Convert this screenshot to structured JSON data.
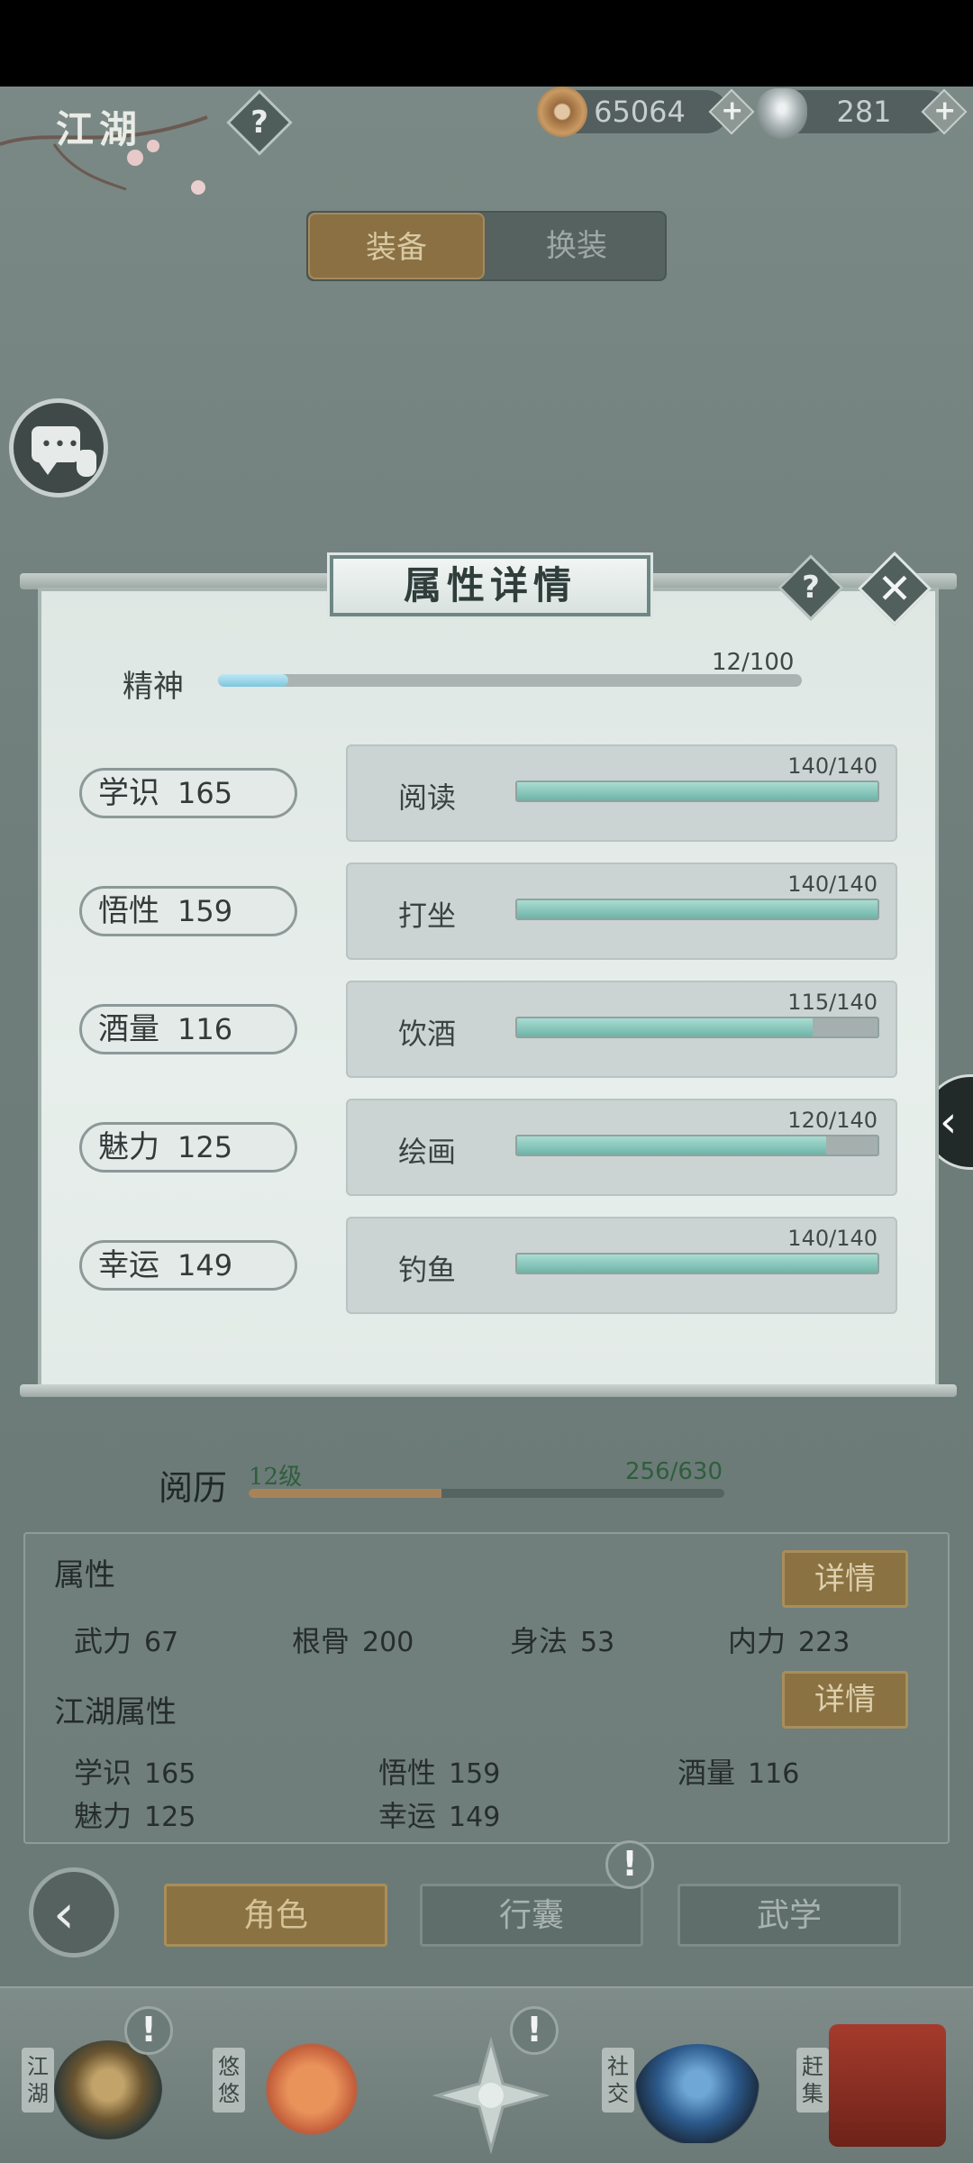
{
  "topbar": {
    "title": "江湖",
    "help_label": "?",
    "coins": "65064",
    "ingots": "281",
    "plus_label": "+"
  },
  "equip_tabs": [
    {
      "label": "装备",
      "active": true
    },
    {
      "label": "换装",
      "active": false
    }
  ],
  "side_arrow_label": "‹",
  "modal": {
    "title": "属性详情",
    "help_label": "?",
    "close_label": "✕",
    "spirit": {
      "label": "精神",
      "value": "12/100",
      "fraction": 0.12
    },
    "stats": [
      {
        "name": "学识",
        "value": "165",
        "skill": "阅读",
        "progress": "140/140",
        "fraction": 1.0
      },
      {
        "name": "悟性",
        "value": "159",
        "skill": "打坐",
        "progress": "140/140",
        "fraction": 1.0
      },
      {
        "name": "酒量",
        "value": "116",
        "skill": "饮酒",
        "progress": "115/140",
        "fraction": 0.821
      },
      {
        "name": "魅力",
        "value": "125",
        "skill": "绘画",
        "progress": "120/140",
        "fraction": 0.857
      },
      {
        "name": "幸运",
        "value": "149",
        "skill": "钓鱼",
        "progress": "140/140",
        "fraction": 1.0
      }
    ]
  },
  "experience": {
    "label": "阅历",
    "level": "12级",
    "value": "256/630",
    "fraction": 0.406
  },
  "attributes": {
    "title": "属性",
    "detail_label": "详情",
    "items": [
      {
        "name": "武力",
        "value": "67"
      },
      {
        "name": "根骨",
        "value": "200"
      },
      {
        "name": "身法",
        "value": "53"
      },
      {
        "name": "内力",
        "value": "223"
      }
    ]
  },
  "jianghu_attributes": {
    "title": "江湖属性",
    "detail_label": "详情",
    "items": [
      {
        "name": "学识",
        "value": "165"
      },
      {
        "name": "悟性",
        "value": "159"
      },
      {
        "name": "酒量",
        "value": "116"
      },
      {
        "name": "魅力",
        "value": "125"
      },
      {
        "name": "幸运",
        "value": "149"
      }
    ]
  },
  "bottom_tabs": [
    {
      "label": "角色",
      "active": true
    },
    {
      "label": "行囊",
      "active": false,
      "alert": "!"
    },
    {
      "label": "武学",
      "active": false
    }
  ],
  "back_label": "‹",
  "nav": [
    {
      "label": "江湖",
      "alert": "!"
    },
    {
      "label": "悠悠"
    },
    {
      "label": "",
      "alert": "!"
    },
    {
      "label": "社交"
    },
    {
      "label": "赶集"
    }
  ],
  "colors": {
    "accent_gold": "#8a7242",
    "teal_fill": "#6fb4a8",
    "panel_bg": "#e3ebe8"
  }
}
